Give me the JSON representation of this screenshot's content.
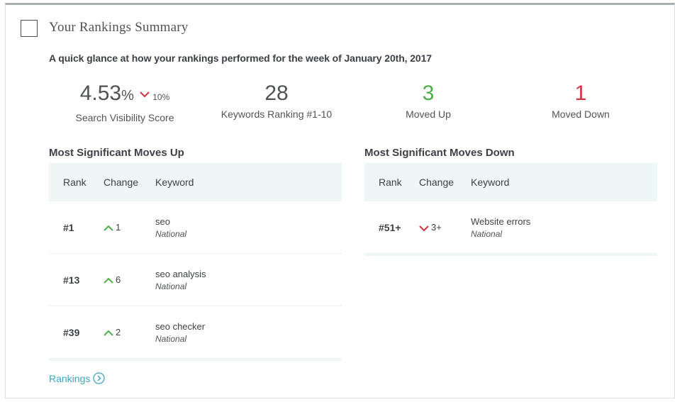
{
  "card": {
    "title": "Your Rankings Summary",
    "subtitle": "A quick glance at how your rankings performed for the week of January 20th, 2017"
  },
  "stats": {
    "visibility": {
      "value": "4.53",
      "unit": "%",
      "change": "10%",
      "label": "Search Visibility Score"
    },
    "top10": {
      "value": "28",
      "label": "Keywords Ranking #1-10"
    },
    "moved_up": {
      "value": "3",
      "label": "Moved Up"
    },
    "moved_down": {
      "value": "1",
      "label": "Moved Down"
    }
  },
  "moves_up": {
    "title": "Most Significant Moves Up",
    "headers": {
      "rank": "Rank",
      "change": "Change",
      "keyword": "Keyword"
    },
    "rows": [
      {
        "rank": "#1",
        "change": "1",
        "keyword": "seo",
        "location": "National"
      },
      {
        "rank": "#13",
        "change": "6",
        "keyword": "seo analysis",
        "location": "National"
      },
      {
        "rank": "#39",
        "change": "2",
        "keyword": "seo checker",
        "location": "National"
      }
    ]
  },
  "moves_down": {
    "title": "Most Significant Moves Down",
    "headers": {
      "rank": "Rank",
      "change": "Change",
      "keyword": "Keyword"
    },
    "rows": [
      {
        "rank": "#51+",
        "change": "3+",
        "keyword": "Website errors",
        "location": "National"
      }
    ]
  },
  "footer": {
    "link_label": "Rankings"
  },
  "colors": {
    "up": "#4fae4a",
    "down": "#d0343f",
    "link": "#3fa3c7",
    "header_bg": "#eef7f6"
  },
  "icons": {
    "up": "chevron-up-icon",
    "down": "chevron-down-icon",
    "link": "chevron-right-circle-icon"
  }
}
